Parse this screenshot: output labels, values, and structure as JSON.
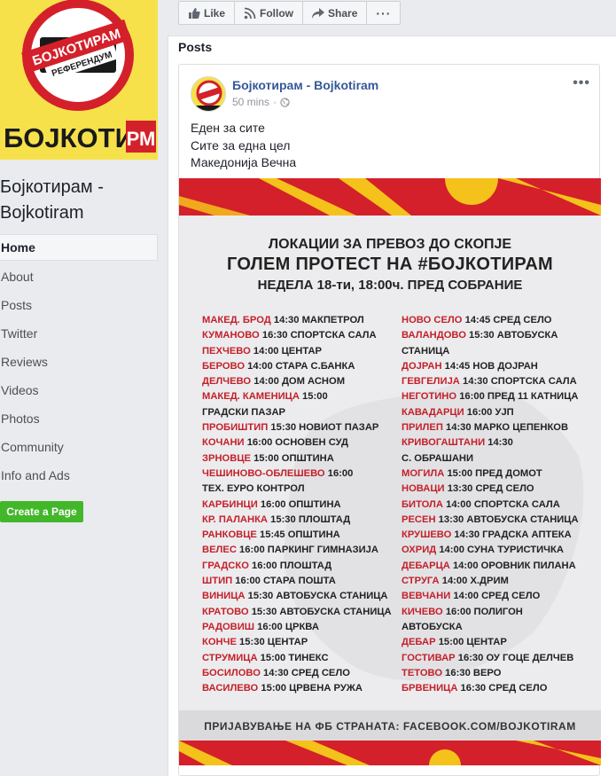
{
  "page": {
    "name": "Бојкотирам - Bojkotiram",
    "logo_text": "БОЈКОТИРАМ",
    "logo_sub": "РЕФЕРЕНДУМ",
    "logo_word": "БОЈКОТИ",
    "logo_suffix": "РМ"
  },
  "nav": {
    "items": [
      "Home",
      "About",
      "Posts",
      "Twitter",
      "Reviews",
      "Videos",
      "Photos",
      "Community",
      "Info and Ads"
    ],
    "create_label": "Create a Page"
  },
  "actions": {
    "like": "Like",
    "follow": "Follow",
    "share": "Share",
    "more": "···"
  },
  "posts": {
    "title": "Posts"
  },
  "post": {
    "author": "Бојкотирам - Bojkotiram",
    "time": "50 mins",
    "separator": "·",
    "menu": "•••",
    "lines": [
      "Еден за сите",
      "Сите за една цел",
      "Македонија Вечна"
    ]
  },
  "poster": {
    "title1": "ЛОКАЦИИ ЗА ПРЕВОЗ ДО СКОПЈЕ",
    "title2": "ГОЛЕМ ПРОТЕСТ НА #БОЈКОТИРАМ",
    "title3": "НЕДЕЛА 18-ти, 18:00ч. ПРЕД СОБРАНИЕ",
    "left": [
      {
        "city": "МАКЕД. БРОД",
        "info": "14:30 МАКПЕТРОЛ"
      },
      {
        "city": "КУМАНОВО",
        "info": "16:30 СПОРТСКА САЛА"
      },
      {
        "city": "ПЕХЧЕВО",
        "info": "14:00 ЦЕНТАР"
      },
      {
        "city": "БЕРОВО",
        "info": "14:00 СТАРА С.БАНКА"
      },
      {
        "city": "ДЕЛЧЕВО",
        "info": "14:00 ДОМ АСНОМ"
      },
      {
        "city": "МАКЕД. КАМЕНИЦА",
        "info": "15:00"
      },
      {
        "city": "",
        "info": "ГРАДСКИ ПАЗАР"
      },
      {
        "city": "ПРОБИШТИП",
        "info": "15:30 НОВИОТ ПАЗАР"
      },
      {
        "city": "КОЧАНИ",
        "info": "16:00 ОСНОВЕН СУД"
      },
      {
        "city": "ЗРНОВЦЕ",
        "info": "15:00 ОПШТИНА"
      },
      {
        "city": "ЧЕШИНОВО-ОБЛЕШЕВО",
        "info": "16:00"
      },
      {
        "city": "",
        "info": "ТЕХ. ЕУРО КОНТРОЛ"
      },
      {
        "city": "КАРБИНЦИ",
        "info": "16:00 ОПШТИНА"
      },
      {
        "city": "КР. ПАЛАНКА",
        "info": "15:30 ПЛОШТАД"
      },
      {
        "city": "РАНКОВЦЕ",
        "info": "15:45 ОПШТИНА"
      },
      {
        "city": "ВЕЛЕС",
        "info": "16:00 ПАРКИНГ ГИМНАЗИЈА"
      },
      {
        "city": "ГРАДСКО",
        "info": "16:00 ПЛОШТАД"
      },
      {
        "city": "ШТИП",
        "info": "16:00 СТАРА ПОШТА"
      },
      {
        "city": "ВИНИЦА",
        "info": "15:30 АВТОБУСКА СТАНИЦА"
      },
      {
        "city": "КРАТОВО",
        "info": "15:30 АВТОБУСКА СТАНИЦА"
      },
      {
        "city": "РАДОВИШ",
        "info": "16:00 ЦРКВА"
      },
      {
        "city": "КОНЧЕ",
        "info": "15:30 ЦЕНТАР"
      },
      {
        "city": "СТРУМИЦА",
        "info": "15:00 ТИНЕКС"
      },
      {
        "city": "БОСИЛОВО",
        "info": "14:30 СРЕД СЕЛО"
      },
      {
        "city": "ВАСИЛЕВО",
        "info": "15:00 ЦРВЕНА РУЖА"
      }
    ],
    "right": [
      {
        "city": "НОВО СЕЛО",
        "info": "14:45 СРЕД СЕЛО"
      },
      {
        "city": "ВАЛАНДОВО",
        "info": "15:30 АВТОБУСКА"
      },
      {
        "city": "",
        "info": "СТАНИЦА"
      },
      {
        "city": "ДОЈРАН",
        "info": "14:45 НОВ ДОЈРАН"
      },
      {
        "city": "ГЕВГЕЛИЈА",
        "info": "14:30 СПОРТСКА САЛА"
      },
      {
        "city": "НЕГОТИНО",
        "info": "16:00 ПРЕД 11 КАТНИЦА"
      },
      {
        "city": "КАВАДАРЦИ",
        "info": "16:00 УЈП"
      },
      {
        "city": "ПРИЛЕП",
        "info": "14:30 МАРКО ЦЕПЕНКОВ"
      },
      {
        "city": "КРИВОГАШТАНИ",
        "info": "14:30"
      },
      {
        "city": "",
        "info": "С. ОБРАШАНИ"
      },
      {
        "city": "МОГИЛА",
        "info": "15:00 ПРЕД ДОМОТ"
      },
      {
        "city": "НОВАЦИ",
        "info": "13:30 СРЕД СЕЛО"
      },
      {
        "city": "БИТОЛА",
        "info": "14:00 СПОРТСКА САЛА"
      },
      {
        "city": "РЕСЕН",
        "info": "13:30 АВТОБУСКА СТАНИЦА"
      },
      {
        "city": "КРУШЕВО",
        "info": "14:30 ГРАДСКА АПТЕКА"
      },
      {
        "city": "ОХРИД",
        "info": "14:00 СУНА ТУРИСТИЧКА"
      },
      {
        "city": "ДЕБАРЦА",
        "info": "14:00 ОРОВНИК ПИЛАНА"
      },
      {
        "city": "СТРУГА",
        "info": "14:00 Х.ДРИМ"
      },
      {
        "city": "ВЕВЧАНИ",
        "info": "14:00 СРЕД СЕЛО"
      },
      {
        "city": "КИЧЕВО",
        "info": "16:00 ПОЛИГОН"
      },
      {
        "city": "",
        "info": "АВТОБУСКА"
      },
      {
        "city": "ДЕБАР",
        "info": "15:00 ЦЕНТАР"
      },
      {
        "city": "ГОСТИВАР",
        "info": "16:30 ОУ ГОЦЕ ДЕЛЧЕВ"
      },
      {
        "city": "ТЕТОВО",
        "info": "16:30 ВЕРО"
      },
      {
        "city": "БРВЕНИЦА",
        "info": "16:30 СРЕД СЕЛО"
      }
    ],
    "footer": "ПРИЈАВУВАЊЕ НА ФБ СТРАНАТА: FACEBOOK.COM/BOJKOTIRAM"
  },
  "colors": {
    "accent_red": "#d4202a",
    "logo_yellow": "#f6e14b",
    "link_blue": "#365899",
    "create_green": "#42b72a"
  }
}
